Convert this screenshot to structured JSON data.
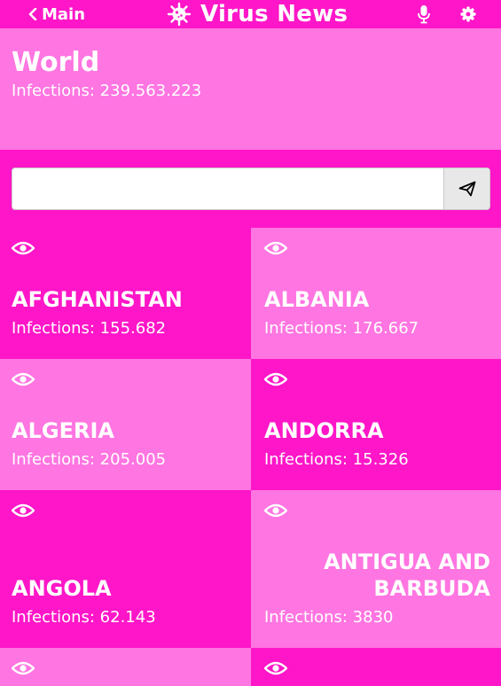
{
  "header": {
    "back_label": "Main",
    "title": "Virus News"
  },
  "world": {
    "name": "World",
    "infections": "Infections: 239.563.223"
  },
  "search": {
    "value": "",
    "placeholder": ""
  },
  "countries": [
    {
      "name": "AFGHANISTAN",
      "infections": "Infections: 155.682"
    },
    {
      "name": "ALBANIA",
      "infections": "Infections: 176.667"
    },
    {
      "name": "ALGERIA",
      "infections": "Infections: 205.005"
    },
    {
      "name": "ANDORRA",
      "infections": "Infections: 15.326"
    },
    {
      "name": "ANGOLA",
      "infections": "Infections: 62.143"
    },
    {
      "name": "ANTIGUA AND BARBUDA",
      "infections": "Infections: 3830"
    }
  ],
  "icons": {
    "back": "chevron-left-icon",
    "logo": "virus-icon",
    "mic": "microphone-icon",
    "settings": "gear-icon",
    "send": "send-icon",
    "view": "eye-icon"
  },
  "colors": {
    "primary": "#ff16c8",
    "secondary": "#ff75e1",
    "text": "#ffffff"
  }
}
